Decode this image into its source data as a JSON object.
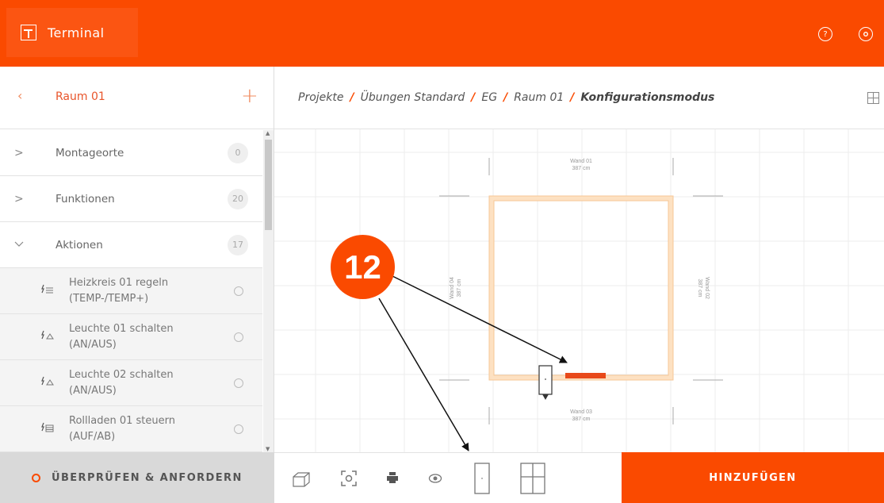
{
  "app": {
    "name": "Terminal"
  },
  "header": {
    "help_icon": "help-icon",
    "settings_icon": "gear-icon"
  },
  "sidebar": {
    "title": "Raum 01",
    "back_glyph": "‹",
    "add_glyph": "+",
    "groups": [
      {
        "label": "Montageorte",
        "count": "0",
        "expanded": false
      },
      {
        "label": "Funktionen",
        "count": "20",
        "expanded": false
      },
      {
        "label": "Aktionen",
        "count": "17",
        "expanded": true
      }
    ],
    "actions": [
      {
        "line1": "Heizkreis 01 regeln",
        "line2": "(TEMP-/TEMP+)",
        "icon": "heating-icon"
      },
      {
        "line1": "Leuchte 01 schalten",
        "line2": "(AN/AUS)",
        "icon": "lamp-icon"
      },
      {
        "line1": "Leuchte 02 schalten",
        "line2": "(AN/AUS)",
        "icon": "lamp-icon"
      },
      {
        "line1": "Rollladen 01 steuern",
        "line2": "(AUF/AB)",
        "icon": "shutter-icon"
      }
    ]
  },
  "breadcrumb": {
    "items": [
      "Projekte",
      "Übungen Standard",
      "EG",
      "Raum 01",
      "Konfigurationsmodus"
    ]
  },
  "canvas": {
    "walls": [
      {
        "name": "Wand 01",
        "length": "387 cm"
      },
      {
        "name": "Wand 02",
        "length": "387 cm"
      },
      {
        "name": "Wand 03",
        "length": "387 cm"
      },
      {
        "name": "Wand 04",
        "length": "387 cm"
      }
    ]
  },
  "footer": {
    "review_label": "ÜBERPRÜFEN & ANFORDERN",
    "add_label": "HINZUFÜGEN"
  },
  "annotation": {
    "number": "12"
  },
  "colors": {
    "accent": "#fa4a00",
    "wall": "#fde1c2",
    "wall_border": "#f6c797"
  }
}
